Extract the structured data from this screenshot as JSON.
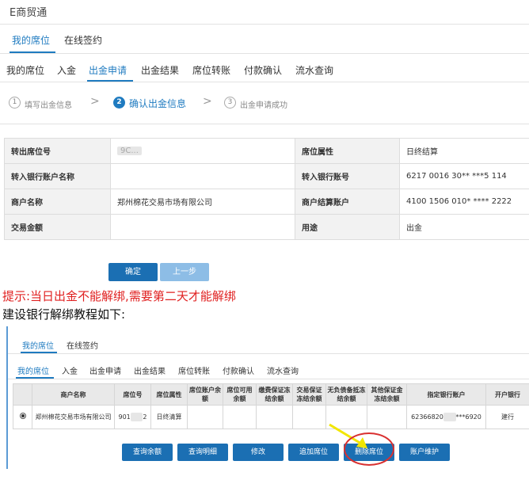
{
  "header": {
    "app_title": "E商贸通"
  },
  "top_tabs": [
    "我的席位",
    "在线签约"
  ],
  "sub_tabs": [
    "我的席位",
    "入金",
    "出金申请",
    "出金结果",
    "席位转账",
    "付款确认",
    "流水查询"
  ],
  "steps": [
    {
      "num": "1",
      "label": "填写出金信息"
    },
    {
      "num": "2",
      "label": "确认出金信息"
    },
    {
      "num": "3",
      "label": "出金申请成功"
    }
  ],
  "step_arrow": ">",
  "info": {
    "rows": [
      {
        "l1": "转出席位号",
        "v1": "9C...",
        "l2": "席位属性",
        "v2": "日终结算"
      },
      {
        "l1": "转入银行账户名称",
        "v1": "",
        "l2": "转入银行账号",
        "v2": "6217 0016 30** ***5 114"
      },
      {
        "l1": "商户名称",
        "v1": "郑州棉花交易市场有限公司",
        "l2": "商户结算账户",
        "v2": "4100 1506 010* **** 2222"
      },
      {
        "l1": "交易金额",
        "v1": "",
        "l2": "用途",
        "v2": "出金"
      }
    ]
  },
  "buttons": {
    "confirm": "确定",
    "back": "上一步"
  },
  "tip": "提示:当日出金不能解绑,需要第二天才能解绑",
  "tutorial": "建设银行解绑教程如下:",
  "inner": {
    "top_tabs": [
      "我的席位",
      "在线签约"
    ],
    "sub_tabs": [
      "我的席位",
      "入金",
      "出金申请",
      "出金结果",
      "席位转账",
      "付款确认",
      "流水查询"
    ],
    "table": {
      "headers": [
        "",
        "商户名称",
        "席位号",
        "席位属性",
        "席位账户余额",
        "席位可用余额",
        "缴费保证冻结余额",
        "交易保证冻结余额",
        "无负债备抵冻结余额",
        "其他保证金冻结余额",
        "指定银行账户",
        "开户银行"
      ],
      "row": {
        "merchant": "郑州棉花交易市场有限公司",
        "seat": "901",
        "seat_suffix": "2",
        "attr": "日终清算",
        "account": "62366820",
        "account_suffix": "***6920",
        "bank": "建行"
      }
    },
    "buttons": [
      "查询余额",
      "查询明细",
      "修改",
      "追加席位",
      "删除席位",
      "账户维护"
    ]
  },
  "colors": {
    "accent": "#1f7bc0",
    "button": "#1b6fb3",
    "tip": "#e02020",
    "annotation": "#d93030",
    "arrow": "#f2e600"
  }
}
